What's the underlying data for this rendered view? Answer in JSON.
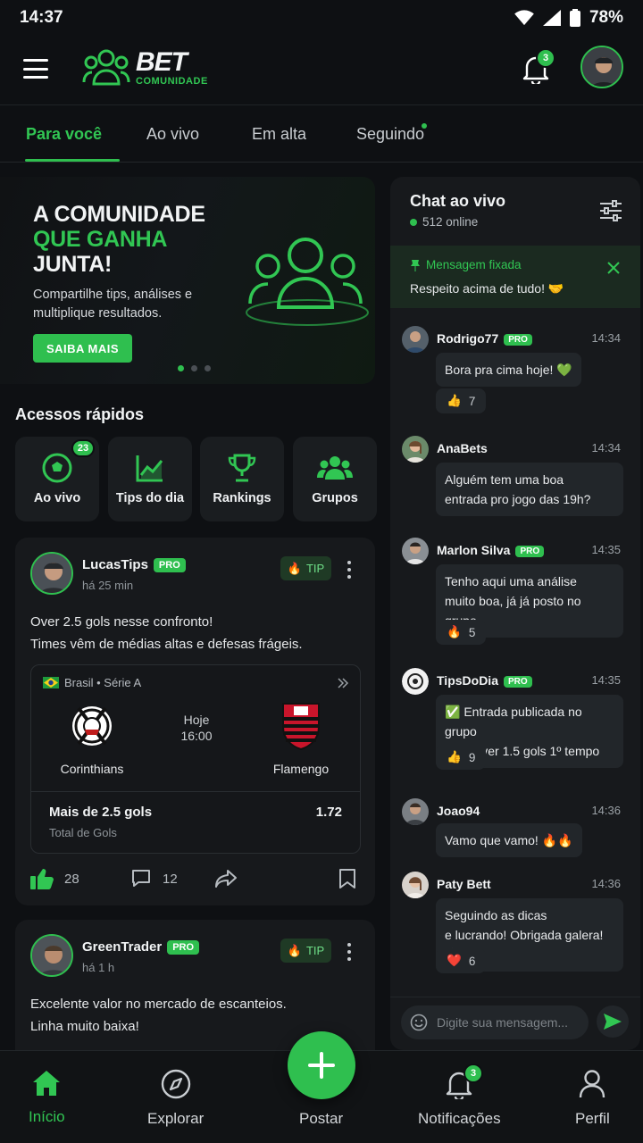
{
  "status": {
    "time": "14:37",
    "battery": "78%"
  },
  "header": {
    "brand": "BET",
    "brand_sub": "COMUNIDADE",
    "notif_count": "3"
  },
  "tabs": [
    {
      "label": "Para você"
    },
    {
      "label": "Ao vivo"
    },
    {
      "label": "Em alta"
    },
    {
      "label": "Seguindo"
    }
  ],
  "banner": {
    "line1": "A COMUNIDADE",
    "line2": "QUE GANHA",
    "line3": "JUNTA!",
    "text": "Compartilhe tips, análises e multiplique resultados.",
    "cta": "SAIBA MAIS"
  },
  "quick": {
    "title": "Acessos rápidos",
    "items": [
      {
        "label": "Ao vivo",
        "badge": "23"
      },
      {
        "label": "Tips do dia"
      },
      {
        "label": "Rankings"
      },
      {
        "label": "Grupos"
      }
    ]
  },
  "posts": [
    {
      "user": "LucasTips",
      "badge": "PRO",
      "time": "há 25 min",
      "tag": "TIP",
      "line1": "Over 2.5 gols nesse confronto!",
      "line2": "Times vêm de médias altas e defesas frágeis.",
      "match": {
        "league": "Brasil • Série A",
        "home": "Corinthians",
        "away": "Flamengo",
        "day": "Hoje",
        "hour": "16:00",
        "market": "Mais de 2.5 gols",
        "market_sub": "Total de Gols",
        "odd": "1.72"
      },
      "likes": "28",
      "comments": "12"
    },
    {
      "user": "GreenTrader",
      "badge": "PRO",
      "time": "há 1 h",
      "tag": "TIP",
      "line1": "Excelente valor no mercado de escanteios.",
      "line2": "Linha muito baixa!"
    }
  ],
  "chat": {
    "title": "Chat ao vivo",
    "online": "512 online",
    "pinned_label": "Mensagem fixada",
    "pinned_text": "Respeito acima de tudo! 🤝",
    "messages": [
      {
        "name": "Rodrigo77",
        "pro": "PRO",
        "time": "14:34",
        "l1": "Bora pra cima hoje! 💚",
        "reaction": "👍",
        "count": "7"
      },
      {
        "name": "AnaBets",
        "time": "14:34",
        "l1": "Alguém tem uma boa",
        "l2": "entrada pro jogo das 19h?"
      },
      {
        "name": "Marlon Silva",
        "pro": "PRO",
        "time": "14:35",
        "l1": "Tenho aqui uma análise",
        "l2": "muito boa, já já posto no grupo.",
        "reaction": "🔥",
        "count": "5"
      },
      {
        "name": "TipsDoDia",
        "pro": "PRO",
        "time": "14:35",
        "l1": "✅ Entrada publicada no grupo",
        "l2": "VIP: Over 1.5 gols 1º tempo",
        "reaction": "👍",
        "count": "9"
      },
      {
        "name": "Joao94",
        "time": "14:36",
        "l1": "Vamo que vamo! 🔥🔥"
      },
      {
        "name": "Paty Bett",
        "time": "14:36",
        "l1": "Seguindo as dicas",
        "l2": "e lucrando! Obrigada galera! 🙌",
        "reaction": "❤️",
        "count": "6"
      }
    ],
    "input_placeholder": "Digite sua mensagem..."
  },
  "nav": [
    {
      "label": "Início"
    },
    {
      "label": "Explorar"
    },
    {
      "label": "Postar"
    },
    {
      "label": "Notificações",
      "badge": "3"
    },
    {
      "label": "Perfil"
    }
  ],
  "colors": {
    "accent": "#2fbf4f",
    "bg": "#0e1013",
    "card": "#17191c"
  }
}
